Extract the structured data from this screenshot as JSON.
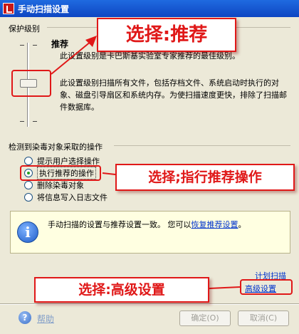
{
  "window": {
    "title": "手动扫描设置"
  },
  "protection_level": {
    "group_label": "保护级别",
    "level_name": "推荐",
    "description_1": "此设置级别是卡巴斯基实验室专家推荐的最佳级别。",
    "description_2": "此设置级别扫描所有文件，包括存档文件、系统启动时执行的对象、磁盘引导扇区和系统内存。为使扫描速度更快，排除了扫描邮件数据库。",
    "slider_positions": 3,
    "slider_selected_index": 1
  },
  "actions": {
    "group_label": "检测到染毒对象采取的操作",
    "options": [
      {
        "label": "提示用户选择操作",
        "checked": false
      },
      {
        "label": "执行推荐的操作",
        "checked": true
      },
      {
        "label": "删除染毒对象",
        "checked": false
      },
      {
        "label": "将信息写入日志文件",
        "checked": false
      }
    ]
  },
  "info": {
    "text": "手动扫描的设置与推荐设置一致。  您可以",
    "link": "恢复推荐设置",
    "suffix": "。"
  },
  "links": {
    "schedule": "计划扫描",
    "advanced": "高级设置"
  },
  "footer": {
    "help": "帮助",
    "ok": "确定(O)",
    "cancel": "取消(C)"
  },
  "annotations": {
    "select_recommended": "选择:推荐",
    "select_action": "选择;指行推荐操作",
    "select_advanced": "选择:高级设置",
    "color": "#e01818"
  }
}
